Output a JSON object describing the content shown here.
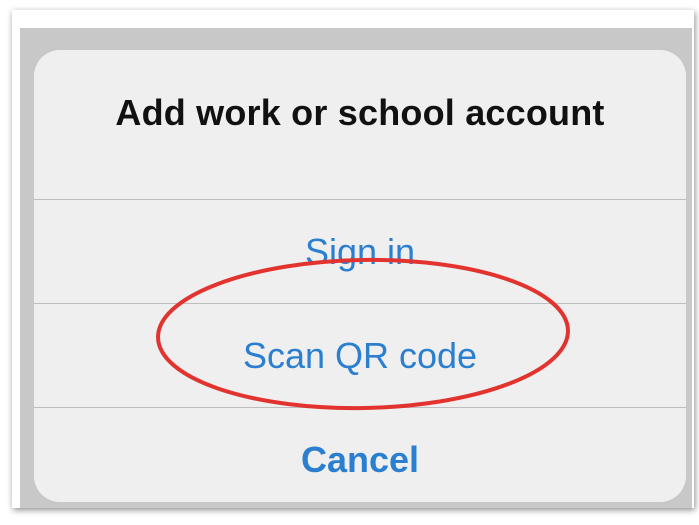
{
  "dialog": {
    "title": "Add work or school account",
    "actions": [
      {
        "label": "Sign in"
      },
      {
        "label": "Scan QR code"
      },
      {
        "label": "Cancel"
      }
    ]
  },
  "colors": {
    "action_text": "#2a7fd0",
    "title_text": "#111111",
    "sheet_background": "#efefef",
    "backdrop": "#c8c8c8",
    "highlight_ring": "#e2332f"
  }
}
